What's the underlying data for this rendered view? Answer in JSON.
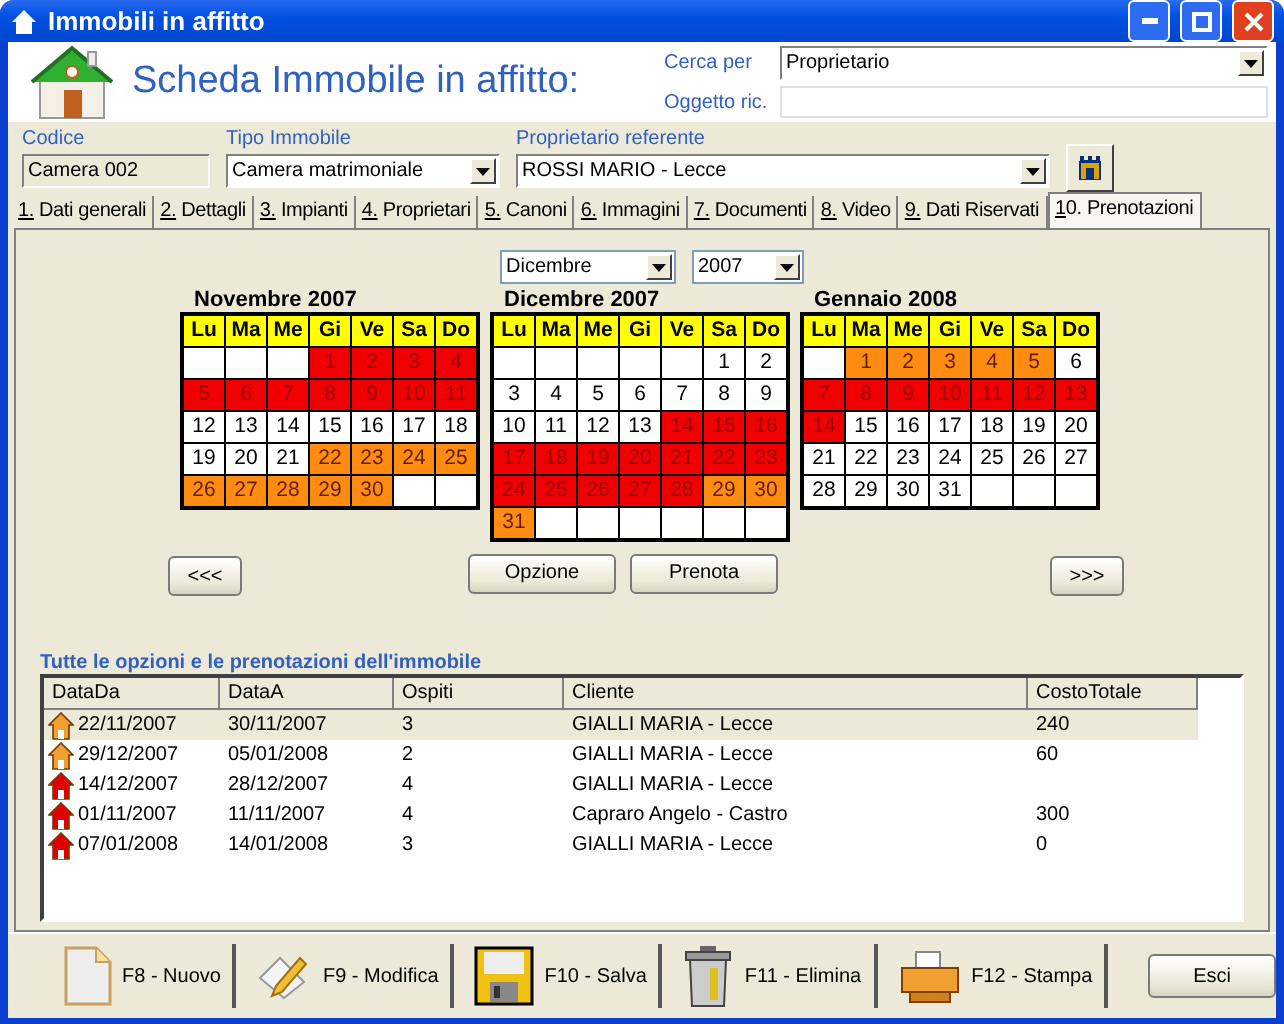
{
  "window": {
    "title": "Immobili in affitto"
  },
  "header": {
    "title": "Scheda Immobile in affitto:",
    "search_by": {
      "label": "Cerca per",
      "value": "Proprietario"
    },
    "search_object": {
      "label": "Oggetto ric."
    }
  },
  "fields": {
    "code": {
      "label": "Codice",
      "value": "Camera 002"
    },
    "type": {
      "label": "Tipo Immobile",
      "value": "Camera matrimoniale"
    },
    "owner": {
      "label": "Proprietario referente",
      "value": "ROSSI MARIO - Lecce"
    }
  },
  "tabs": [
    {
      "label": "1. Dati generali",
      "selected": false
    },
    {
      "label": "2. Dettagli",
      "selected": false
    },
    {
      "label": "3. Impianti",
      "selected": false
    },
    {
      "label": "4. Proprietari",
      "selected": false
    },
    {
      "label": "5. Canoni",
      "selected": false
    },
    {
      "label": "6. Immagini",
      "selected": false
    },
    {
      "label": "7. Documenti",
      "selected": false
    },
    {
      "label": "8. Video",
      "selected": false
    },
    {
      "label": "9. Dati Riservati",
      "selected": false
    },
    {
      "label": "10. Prenotazioni",
      "selected": true
    }
  ],
  "month_select": {
    "month": "Dicembre",
    "year": "2007"
  },
  "calendars": [
    {
      "title": "Novembre 2007",
      "weekdays": [
        "Lu",
        "Ma",
        "Me",
        "Gi",
        "Ve",
        "Sa",
        "Do"
      ],
      "weeks": [
        [
          {
            "kind": "empty"
          },
          {
            "kind": "empty"
          },
          {
            "kind": "empty"
          },
          {
            "day": "1",
            "kind": "booked"
          },
          {
            "day": "2",
            "kind": "booked"
          },
          {
            "day": "3",
            "kind": "booked"
          },
          {
            "day": "4",
            "kind": "booked"
          }
        ],
        [
          {
            "day": "5",
            "kind": "booked"
          },
          {
            "day": "6",
            "kind": "booked"
          },
          {
            "day": "7",
            "kind": "booked"
          },
          {
            "day": "8",
            "kind": "booked"
          },
          {
            "day": "9",
            "kind": "booked"
          },
          {
            "day": "10",
            "kind": "booked"
          },
          {
            "day": "11",
            "kind": "booked"
          }
        ],
        [
          {
            "day": "12",
            "kind": "free"
          },
          {
            "day": "13",
            "kind": "free"
          },
          {
            "day": "14",
            "kind": "free"
          },
          {
            "day": "15",
            "kind": "free"
          },
          {
            "day": "16",
            "kind": "free"
          },
          {
            "day": "17",
            "kind": "free"
          },
          {
            "day": "18",
            "kind": "free"
          }
        ],
        [
          {
            "day": "19",
            "kind": "free"
          },
          {
            "day": "20",
            "kind": "free"
          },
          {
            "day": "21",
            "kind": "free"
          },
          {
            "day": "22",
            "kind": "option"
          },
          {
            "day": "23",
            "kind": "option"
          },
          {
            "day": "24",
            "kind": "option"
          },
          {
            "day": "25",
            "kind": "option"
          }
        ],
        [
          {
            "day": "26",
            "kind": "option"
          },
          {
            "day": "27",
            "kind": "option"
          },
          {
            "day": "28",
            "kind": "option"
          },
          {
            "day": "29",
            "kind": "option"
          },
          {
            "day": "30",
            "kind": "option"
          },
          {
            "kind": "empty"
          },
          {
            "kind": "empty"
          }
        ]
      ]
    },
    {
      "title": "Dicembre 2007",
      "weekdays": [
        "Lu",
        "Ma",
        "Me",
        "Gi",
        "Ve",
        "Sa",
        "Do"
      ],
      "weeks": [
        [
          {
            "kind": "empty"
          },
          {
            "kind": "empty"
          },
          {
            "kind": "empty"
          },
          {
            "kind": "empty"
          },
          {
            "kind": "empty"
          },
          {
            "day": "1",
            "kind": "free"
          },
          {
            "day": "2",
            "kind": "free"
          }
        ],
        [
          {
            "day": "3",
            "kind": "free"
          },
          {
            "day": "4",
            "kind": "free"
          },
          {
            "day": "5",
            "kind": "free"
          },
          {
            "day": "6",
            "kind": "free"
          },
          {
            "day": "7",
            "kind": "free"
          },
          {
            "day": "8",
            "kind": "free"
          },
          {
            "day": "9",
            "kind": "free"
          }
        ],
        [
          {
            "day": "10",
            "kind": "free"
          },
          {
            "day": "11",
            "kind": "free"
          },
          {
            "day": "12",
            "kind": "free"
          },
          {
            "day": "13",
            "kind": "free"
          },
          {
            "day": "14",
            "kind": "booked"
          },
          {
            "day": "15",
            "kind": "booked"
          },
          {
            "day": "16",
            "kind": "booked"
          }
        ],
        [
          {
            "day": "17",
            "kind": "booked"
          },
          {
            "day": "18",
            "kind": "booked"
          },
          {
            "day": "19",
            "kind": "booked"
          },
          {
            "day": "20",
            "kind": "booked"
          },
          {
            "day": "21",
            "kind": "booked"
          },
          {
            "day": "22",
            "kind": "booked"
          },
          {
            "day": "23",
            "kind": "booked"
          }
        ],
        [
          {
            "day": "24",
            "kind": "booked"
          },
          {
            "day": "25",
            "kind": "booked"
          },
          {
            "day": "26",
            "kind": "booked"
          },
          {
            "day": "27",
            "kind": "booked"
          },
          {
            "day": "28",
            "kind": "booked"
          },
          {
            "day": "29",
            "kind": "option"
          },
          {
            "day": "30",
            "kind": "option"
          }
        ],
        [
          {
            "day": "31",
            "kind": "option"
          },
          {
            "kind": "empty"
          },
          {
            "kind": "empty"
          },
          {
            "kind": "empty"
          },
          {
            "kind": "empty"
          },
          {
            "kind": "empty"
          },
          {
            "kind": "empty"
          }
        ]
      ]
    },
    {
      "title": "Gennaio 2008",
      "weekdays": [
        "Lu",
        "Ma",
        "Me",
        "Gi",
        "Ve",
        "Sa",
        "Do"
      ],
      "weeks": [
        [
          {
            "kind": "empty"
          },
          {
            "day": "1",
            "kind": "option"
          },
          {
            "day": "2",
            "kind": "option"
          },
          {
            "day": "3",
            "kind": "option"
          },
          {
            "day": "4",
            "kind": "option"
          },
          {
            "day": "5",
            "kind": "option"
          },
          {
            "day": "6",
            "kind": "free"
          }
        ],
        [
          {
            "day": "7",
            "kind": "booked"
          },
          {
            "day": "8",
            "kind": "booked"
          },
          {
            "day": "9",
            "kind": "booked"
          },
          {
            "day": "10",
            "kind": "booked"
          },
          {
            "day": "11",
            "kind": "booked"
          },
          {
            "day": "12",
            "kind": "booked"
          },
          {
            "day": "13",
            "kind": "booked"
          }
        ],
        [
          {
            "day": "14",
            "kind": "booked"
          },
          {
            "day": "15",
            "kind": "free"
          },
          {
            "day": "16",
            "kind": "free"
          },
          {
            "day": "17",
            "kind": "free"
          },
          {
            "day": "18",
            "kind": "free"
          },
          {
            "day": "19",
            "kind": "free"
          },
          {
            "day": "20",
            "kind": "free"
          }
        ],
        [
          {
            "day": "21",
            "kind": "free"
          },
          {
            "day": "22",
            "kind": "free"
          },
          {
            "day": "23",
            "kind": "free"
          },
          {
            "day": "24",
            "kind": "free"
          },
          {
            "day": "25",
            "kind": "free"
          },
          {
            "day": "26",
            "kind": "free"
          },
          {
            "day": "27",
            "kind": "free"
          }
        ],
        [
          {
            "day": "28",
            "kind": "free"
          },
          {
            "day": "29",
            "kind": "free"
          },
          {
            "day": "30",
            "kind": "free"
          },
          {
            "day": "31",
            "kind": "free"
          },
          {
            "kind": "empty"
          },
          {
            "kind": "empty"
          },
          {
            "kind": "empty"
          }
        ]
      ]
    }
  ],
  "nav": {
    "prev": "<<<",
    "next": ">>>",
    "actions": [
      "Opzione",
      "Prenota"
    ]
  },
  "bookings": {
    "title": "Tutte le opzioni e le prenotazioni dell'immobile",
    "columns": [
      "DataDa",
      "DataA",
      "Ospiti",
      "Cliente",
      "CostoTotale"
    ],
    "rows": [
      {
        "kind": "option",
        "selected": true,
        "cells": [
          "22/11/2007",
          "30/11/2007",
          "3",
          "GIALLI MARIA - Lecce",
          "240"
        ]
      },
      {
        "kind": "option",
        "selected": false,
        "cells": [
          "29/12/2007",
          "05/01/2008",
          "2",
          "GIALLI MARIA - Lecce",
          "60"
        ]
      },
      {
        "kind": "booked",
        "selected": false,
        "cells": [
          "14/12/2007",
          "28/12/2007",
          "4",
          "GIALLI MARIA - Lecce",
          null
        ]
      },
      {
        "kind": "booked",
        "selected": false,
        "cells": [
          "01/11/2007",
          "11/11/2007",
          "4",
          "Capraro Angelo - Castro",
          "300"
        ]
      },
      {
        "kind": "booked",
        "selected": false,
        "cells": [
          "07/01/2008",
          "14/01/2008",
          "3",
          "GIALLI MARIA - Lecce",
          "0"
        ]
      }
    ]
  },
  "toolbar": [
    {
      "kind": "new",
      "label": "F8 - Nuovo"
    },
    {
      "kind": "edit",
      "label": "F9 - Modifica"
    },
    {
      "kind": "save",
      "label": "F10 - Salva"
    },
    {
      "kind": "delete",
      "label": "F11 - Elimina"
    },
    {
      "kind": "print",
      "label": "F12 - Stampa"
    }
  ],
  "exit_button": "Esci"
}
